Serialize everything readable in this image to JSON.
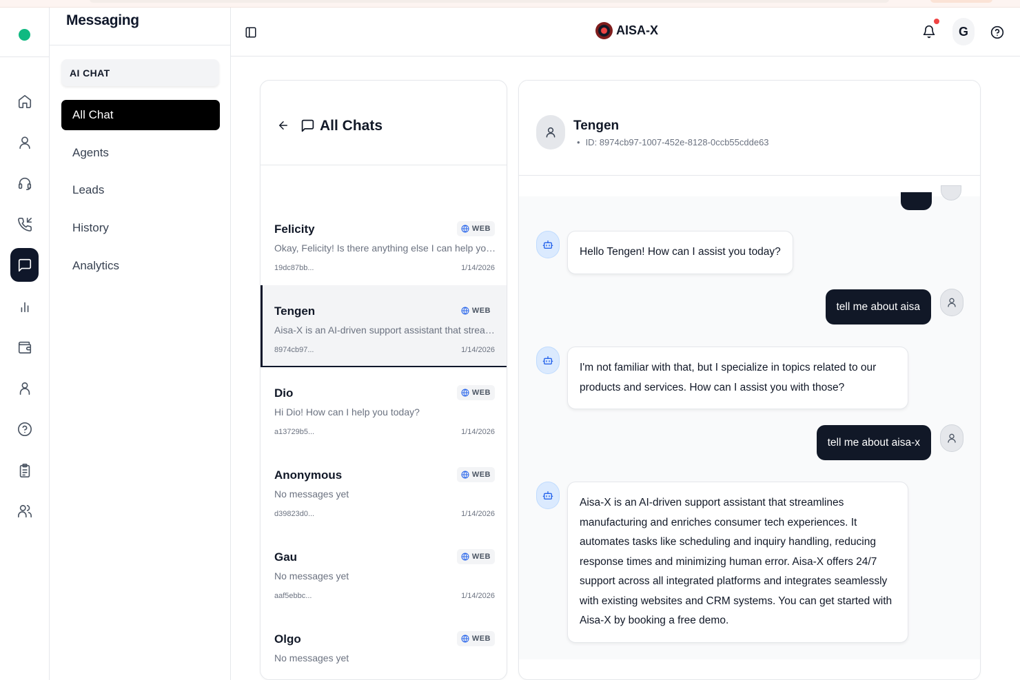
{
  "rail": {
    "items": [
      {
        "icon": "home-icon",
        "active": false
      },
      {
        "icon": "user-icon",
        "active": false
      },
      {
        "icon": "headset-icon",
        "active": false
      },
      {
        "icon": "phone-incoming-icon",
        "active": false
      },
      {
        "icon": "message-square-icon",
        "active": true
      },
      {
        "icon": "bar-chart-icon",
        "active": false
      },
      {
        "icon": "wallet-icon",
        "active": false
      },
      {
        "icon": "contact-icon",
        "active": false
      },
      {
        "icon": "help-circle-icon",
        "active": false
      },
      {
        "icon": "clipboard-list-icon",
        "active": false
      },
      {
        "icon": "users-icon",
        "active": false
      }
    ]
  },
  "subnav": {
    "title": "Messaging",
    "section": "AI CHAT",
    "items": [
      "All Chat",
      "Agents",
      "Leads",
      "History",
      "Analytics"
    ],
    "active": "All Chat"
  },
  "header": {
    "brand": "AISA-X",
    "user_initial": "G"
  },
  "chat_list": {
    "title": "All Chats",
    "chats": [
      {
        "name": "Felicity",
        "channel": "WEB",
        "preview": "Okay, Felicity! Is there anything else I can help you wi...",
        "id": "19dc87bb...",
        "date": "1/14/2026"
      },
      {
        "name": "Tengen",
        "channel": "WEB",
        "preview": "Aisa-X is an AI-driven support assistant that streamli...",
        "id": "8974cb97...",
        "date": "1/14/2026"
      },
      {
        "name": "Dio",
        "channel": "WEB",
        "preview": "Hi Dio! How can I help you today?",
        "id": "a13729b5...",
        "date": "1/14/2026"
      },
      {
        "name": "Anonymous",
        "channel": "WEB",
        "preview": "No messages yet",
        "id": "d39823d0...",
        "date": "1/14/2026"
      },
      {
        "name": "Gau",
        "channel": "WEB",
        "preview": "No messages yet",
        "id": "aaf5ebbc...",
        "date": "1/14/2026"
      },
      {
        "name": "Olgo",
        "channel": "WEB",
        "preview": "No messages yet",
        "id": "",
        "date": ""
      }
    ]
  },
  "conversation": {
    "name": "Tengen",
    "id_label": "ID: 8974cb97-1007-452e-8128-0ccb55cdde63",
    "messages": [
      {
        "from": "bot",
        "text": "Hello Tengen! How can I assist you today?"
      },
      {
        "from": "user",
        "text": "tell me about aisa"
      },
      {
        "from": "bot",
        "text": "I'm not familiar with that, but I specialize in topics related to our products and services. How can I assist you with those?"
      },
      {
        "from": "user",
        "text": "tell me about aisa-x"
      },
      {
        "from": "bot",
        "text": "Aisa-X is an AI-driven support assistant that streamlines manufacturing and enriches consumer tech experiences. It automates tasks like scheduling and inquiry handling, reducing response times and minimizing human error. Aisa-X offers 24/7 support across all integrated platforms and integrates seamlessly with existing websites and CRM systems. You can get started with Aisa-X by booking a free demo."
      }
    ]
  }
}
